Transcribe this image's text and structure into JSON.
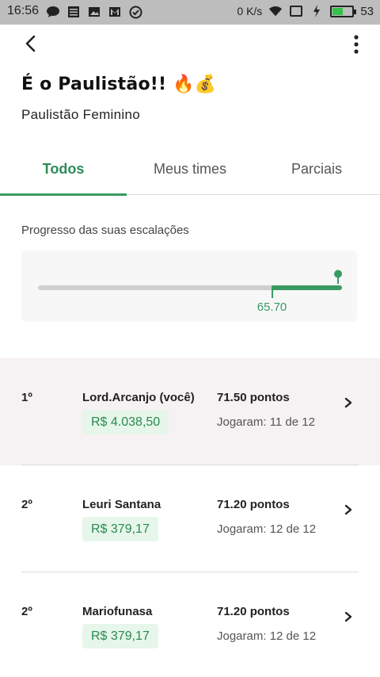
{
  "status_bar": {
    "time": "16:56",
    "speed": "0 K/s",
    "battery": "53",
    "battery_level_pct": 53,
    "battery_color": "#34c24a"
  },
  "header": {
    "back_icon": "chevron-left-icon",
    "more_icon": "more-vertical-icon",
    "title": "É o Paulistão!! 🔥💰",
    "subtitle": "Paulistão Feminino"
  },
  "tabs": [
    {
      "label": "Todos",
      "active": true
    },
    {
      "label": "Meus times",
      "active": false
    },
    {
      "label": "Parciais",
      "active": false
    }
  ],
  "progress": {
    "label": "Progresso das suas escalações",
    "value_label": "65.70",
    "value_fraction": 0.767,
    "end_fraction": 1.0,
    "accent": "#3a9a62"
  },
  "ranking": [
    {
      "rank": "1º",
      "name": "Lord.Arcanjo (você)",
      "prize": "R$ 4.038,50",
      "points": "71.50 pontos",
      "played": "Jogaram: 11 de 12",
      "is_user": true
    },
    {
      "rank": "2º",
      "name": "Leuri Santana",
      "prize": "R$ 379,17",
      "points": "71.20 pontos",
      "played": "Jogaram: 12 de 12",
      "is_user": false
    },
    {
      "rank": "2º",
      "name": "Mariofunasa",
      "prize": "R$ 379,17",
      "points": "71.20 pontos",
      "played": "Jogaram: 12 de 12",
      "is_user": false
    }
  ]
}
